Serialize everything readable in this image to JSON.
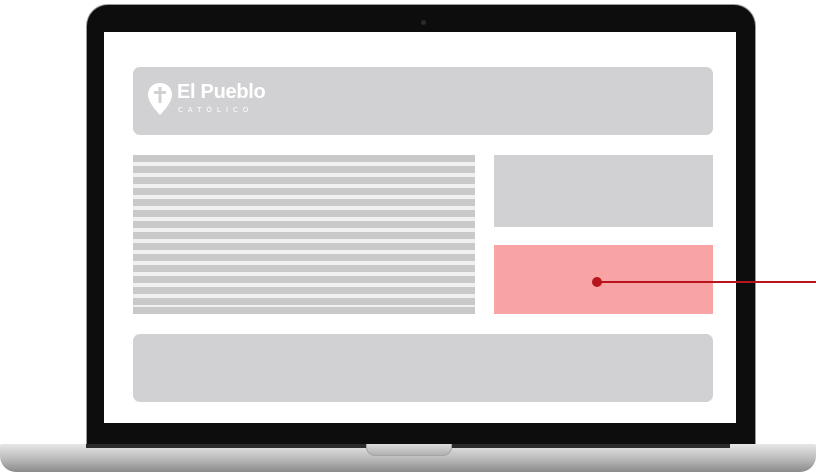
{
  "brand": {
    "title": "El Pueblo",
    "subtitle": "CATÓLICO",
    "icon": "cross-pin-icon"
  },
  "colors": {
    "placeholder_gray": "#d1d1d3",
    "highlight_red": "#f9a4a4",
    "pointer_red": "#b8141d",
    "bezel": "#0d0d0d"
  }
}
